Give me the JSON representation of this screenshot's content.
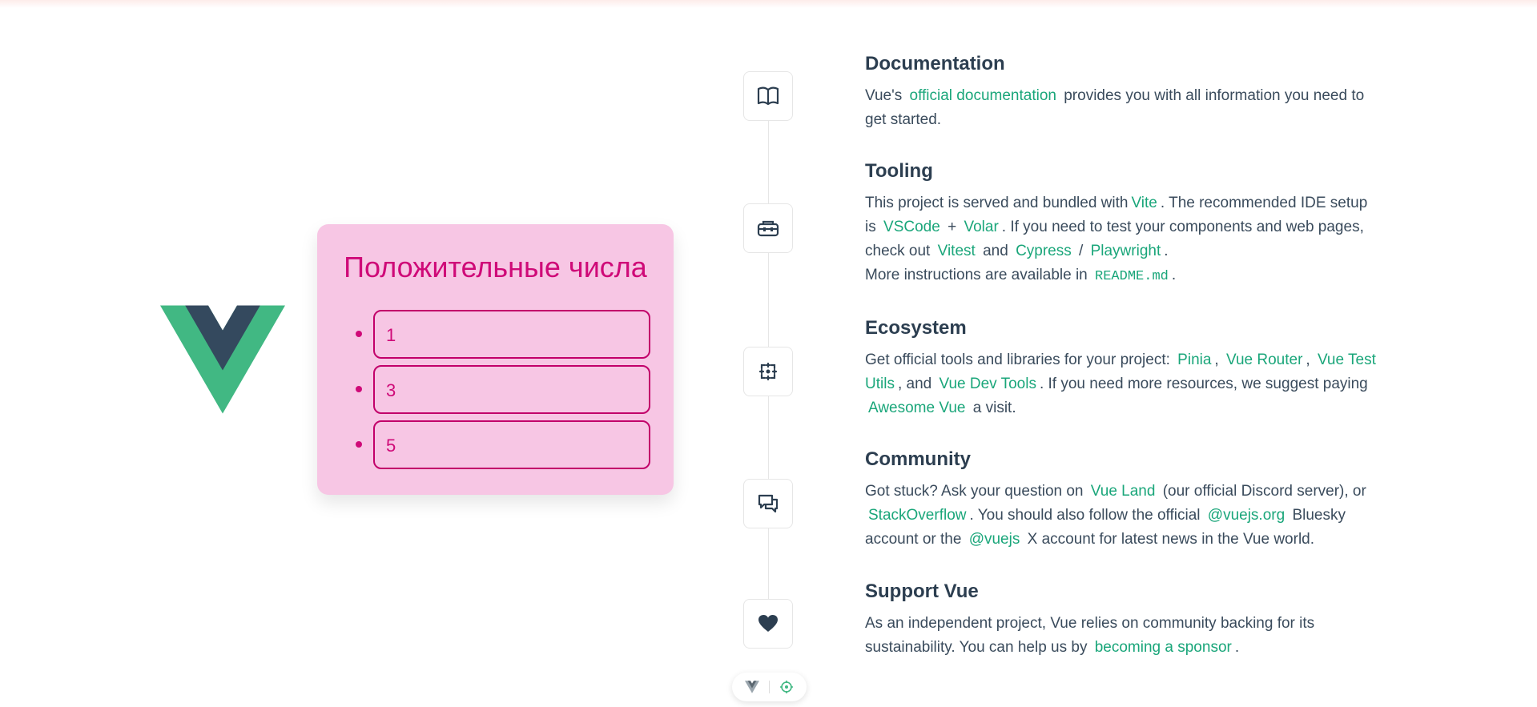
{
  "card": {
    "title": "Положительные числа",
    "items": [
      "1",
      "3",
      "5"
    ]
  },
  "sections": {
    "documentation": {
      "title": "Documentation",
      "t1": "Vue's",
      "link1": "official documentation",
      "t2": "provides you with all information you need to get started."
    },
    "tooling": {
      "title": "Tooling",
      "t1": "This project is served and bundled with",
      "link_vite": "Vite",
      "t2": ". The recommended IDE setup is",
      "link_vscode": "VSCode",
      "t3": "+",
      "link_volar": "Volar",
      "t4": ". If you need to test your components and web pages, check out",
      "link_vitest": "Vitest",
      "t5": "and",
      "link_cypress": "Cypress",
      "t6": "/",
      "link_playwright": "Playwright",
      "t7": ".",
      "t8": "More instructions are available in",
      "code_readme": "README.md",
      "t9": "."
    },
    "ecosystem": {
      "title": "Ecosystem",
      "t1": "Get official tools and libraries for your project:",
      "link_pinia": "Pinia",
      "t2": ",",
      "link_router": "Vue Router",
      "t3": ",",
      "link_testutils": "Vue Test Utils",
      "t4": ", and",
      "link_devtools": "Vue Dev Tools",
      "t5": ". If you need more resources, we suggest paying",
      "link_awesome": "Awesome Vue",
      "t6": "a visit."
    },
    "community": {
      "title": "Community",
      "t1": "Got stuck? Ask your question on",
      "link_vueland": "Vue Land",
      "t2": "(our official Discord server), or",
      "link_stackoverflow": "StackOverflow",
      "t3": ". You should also follow the official",
      "link_bluesky": "@vuejs.org",
      "t4": "Bluesky account or the",
      "link_x": "@vuejs",
      "t5": "X account for latest news in the Vue world."
    },
    "support": {
      "title": "Support Vue",
      "t1": "As an independent project, Vue relies on community backing for its sustainability. You can help us by",
      "link_sponsor": "becoming a sponsor",
      "t2": "."
    }
  },
  "icons": {
    "documentation": "book-icon",
    "tooling": "toolbox-icon",
    "ecosystem": "ecosystem-icon",
    "community": "chat-bubbles-icon",
    "support": "heart-icon"
  },
  "colors": {
    "accent": "#1aa67a",
    "card_bg": "#f7c6e4",
    "card_text": "#cf0a78",
    "heading": "#2c3e50",
    "vue_green": "#41b883",
    "vue_dark": "#34495e"
  }
}
